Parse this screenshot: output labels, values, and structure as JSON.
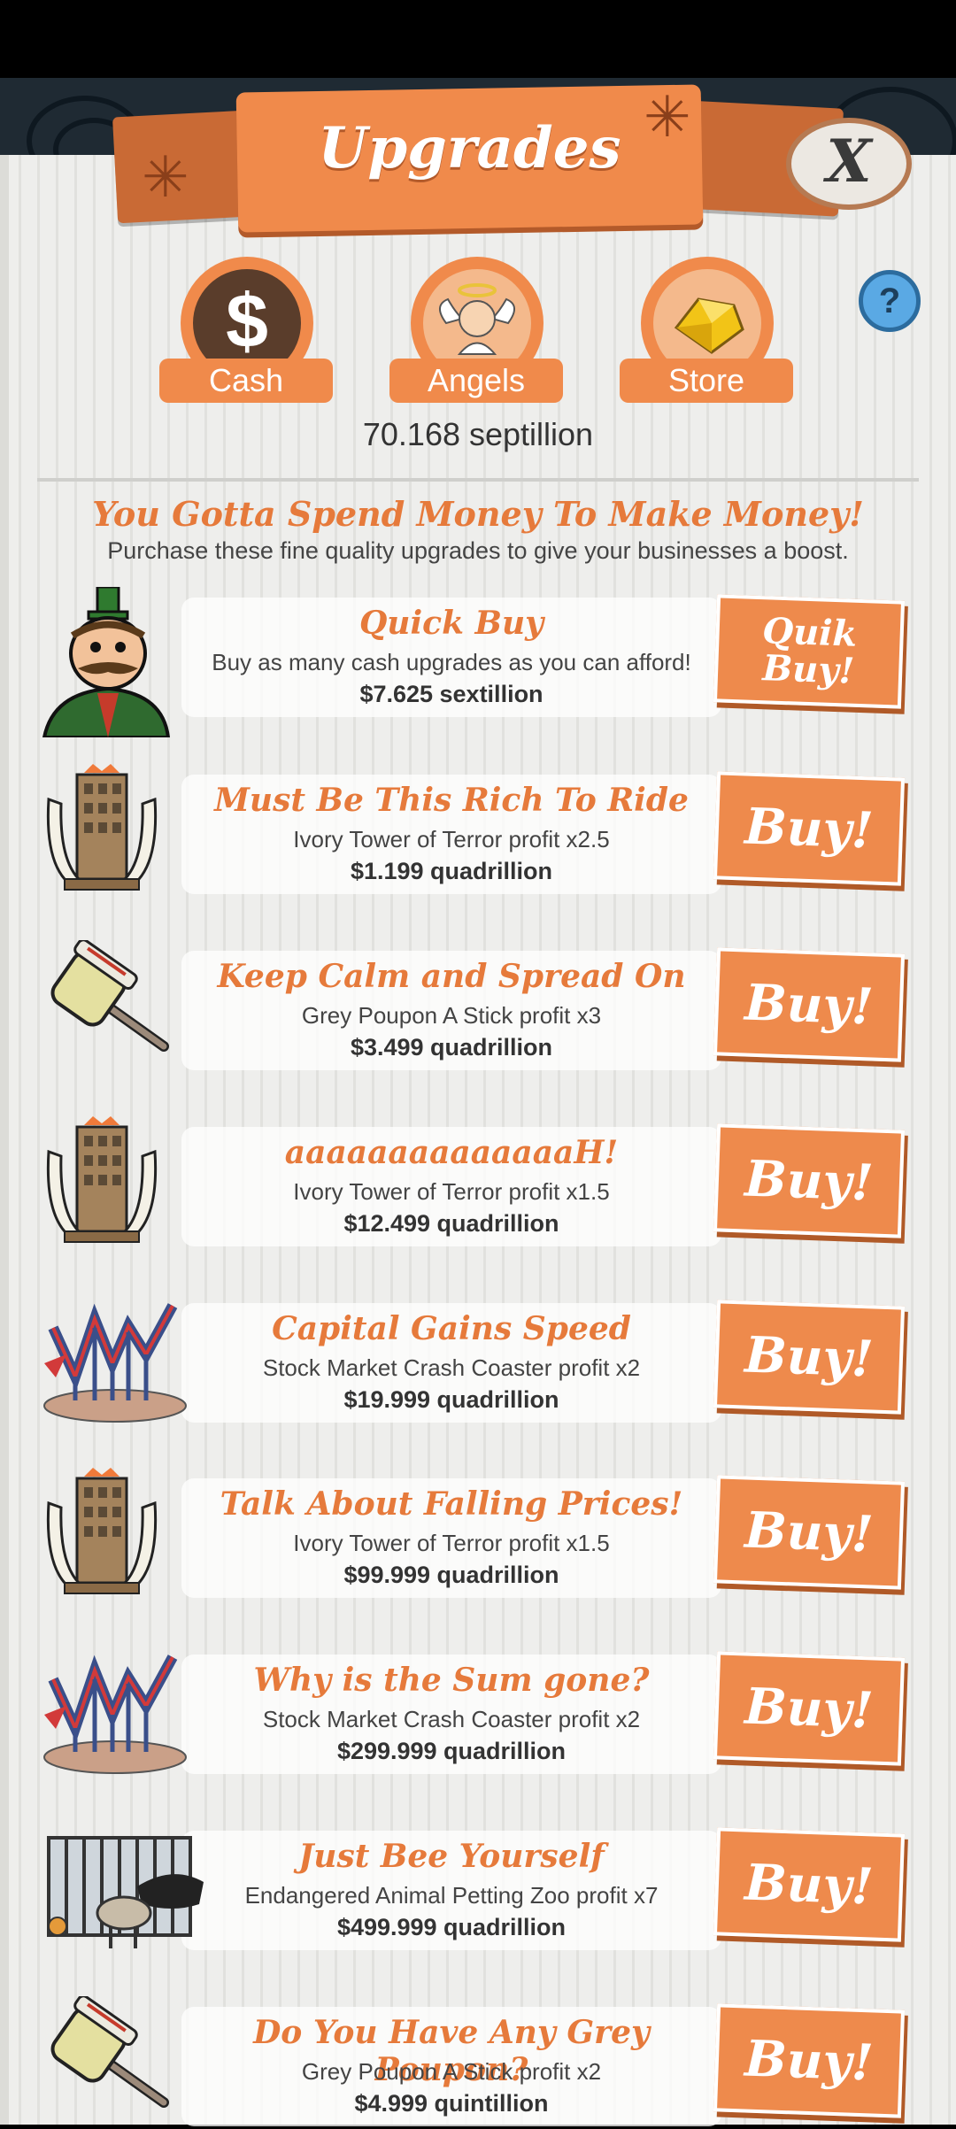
{
  "header": {
    "title": "Upgrades",
    "close_label": "X",
    "help_label": "?"
  },
  "tabs": [
    {
      "label": "Cash",
      "icon": "dollar-icon"
    },
    {
      "label": "Angels",
      "icon": "angel-icon"
    },
    {
      "label": "Store",
      "icon": "gold-gem-icon"
    }
  ],
  "balance": "70.168 septillion",
  "intro": {
    "headline": "You Gotta Spend Money To Make Money!",
    "subline": "Purchase these fine quality upgrades to give your businesses a boost."
  },
  "upgrades": [
    {
      "title": "Quick Buy",
      "desc": "Buy as many cash upgrades as you can afford!",
      "price": "$7.625 sextillion",
      "button": "Quik Buy!",
      "icon": "mustache-mogul-icon"
    },
    {
      "title": "Must Be This Rich To Ride",
      "desc": "Ivory Tower of Terror profit x2.5",
      "price": "$1.199 quadrillion",
      "button": "Buy!",
      "icon": "ivory-tower-icon"
    },
    {
      "title": "Keep Calm and Spread On",
      "desc": "Grey Poupon A Stick profit x3",
      "price": "$3.499 quadrillion",
      "button": "Buy!",
      "icon": "mustard-stick-icon"
    },
    {
      "title": "aaaaaaaaaaaaaaH!",
      "desc": "Ivory Tower of Terror profit x1.5",
      "price": "$12.499 quadrillion",
      "button": "Buy!",
      "icon": "ivory-tower-icon"
    },
    {
      "title": "Capital Gains Speed",
      "desc": "Stock Market Crash Coaster profit x2",
      "price": "$19.999 quadrillion",
      "button": "Buy!",
      "icon": "crash-coaster-icon"
    },
    {
      "title": "Talk About Falling Prices!",
      "desc": "Ivory Tower of Terror profit x1.5",
      "price": "$99.999 quadrillion",
      "button": "Buy!",
      "icon": "ivory-tower-icon"
    },
    {
      "title": "Why is the Sum gone?",
      "desc": "Stock Market Crash Coaster profit x2",
      "price": "$299.999 quadrillion",
      "button": "Buy!",
      "icon": "crash-coaster-icon"
    },
    {
      "title": "Just Bee Yourself",
      "desc": "Endangered Animal Petting Zoo profit x7",
      "price": "$499.999 quadrillion",
      "button": "Buy!",
      "icon": "petting-zoo-icon"
    },
    {
      "title": "Do You Have Any Grey Poupon?",
      "desc": "Grey Poupon A Stick profit x2",
      "price": "$4.999 quintillion",
      "button": "Buy!",
      "icon": "mustard-stick-icon"
    }
  ],
  "colors": {
    "accent": "#f08a4b",
    "accent_dark": "#b35a2a",
    "title_text": "#e67a3b",
    "panel": "#eeeeec"
  }
}
